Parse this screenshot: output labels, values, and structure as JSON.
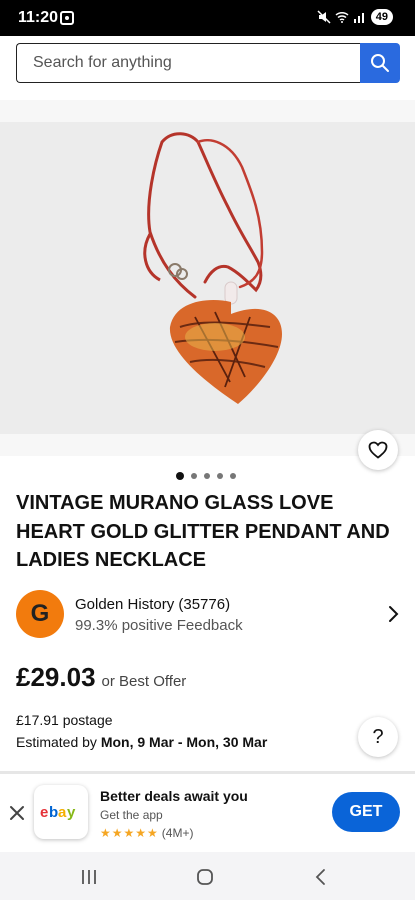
{
  "status_bar": {
    "time": "11:20",
    "battery": "49"
  },
  "search": {
    "placeholder": "Search for anything",
    "icon": "search-icon"
  },
  "product": {
    "image_dots": {
      "count": 5,
      "active": 0
    },
    "favourite_icon": "heart-icon",
    "title": "VINTAGE MURANO GLASS LOVE HEART GOLD GLITTER PENDANT AND LADIES NECKLACE"
  },
  "seller": {
    "avatar_letter": "G",
    "avatar_color": "#f27b0d",
    "name": "Golden History (35776)",
    "feedback": "99.3% positive Feedback"
  },
  "price": {
    "amount": "£29.03",
    "offer_text": "or Best Offer"
  },
  "shipping": {
    "postage": "£17.91 postage",
    "estimated_label": "Estimated by",
    "estimated_dates": "Mon, 9 Mar - Mon, 30 Mar"
  },
  "help": {
    "label": "?"
  },
  "app_banner": {
    "title": "Better deals await you",
    "subtitle": "Get the app",
    "rating_count": "(4M+)",
    "get_label": "GET",
    "accent": "#0a64d8"
  }
}
